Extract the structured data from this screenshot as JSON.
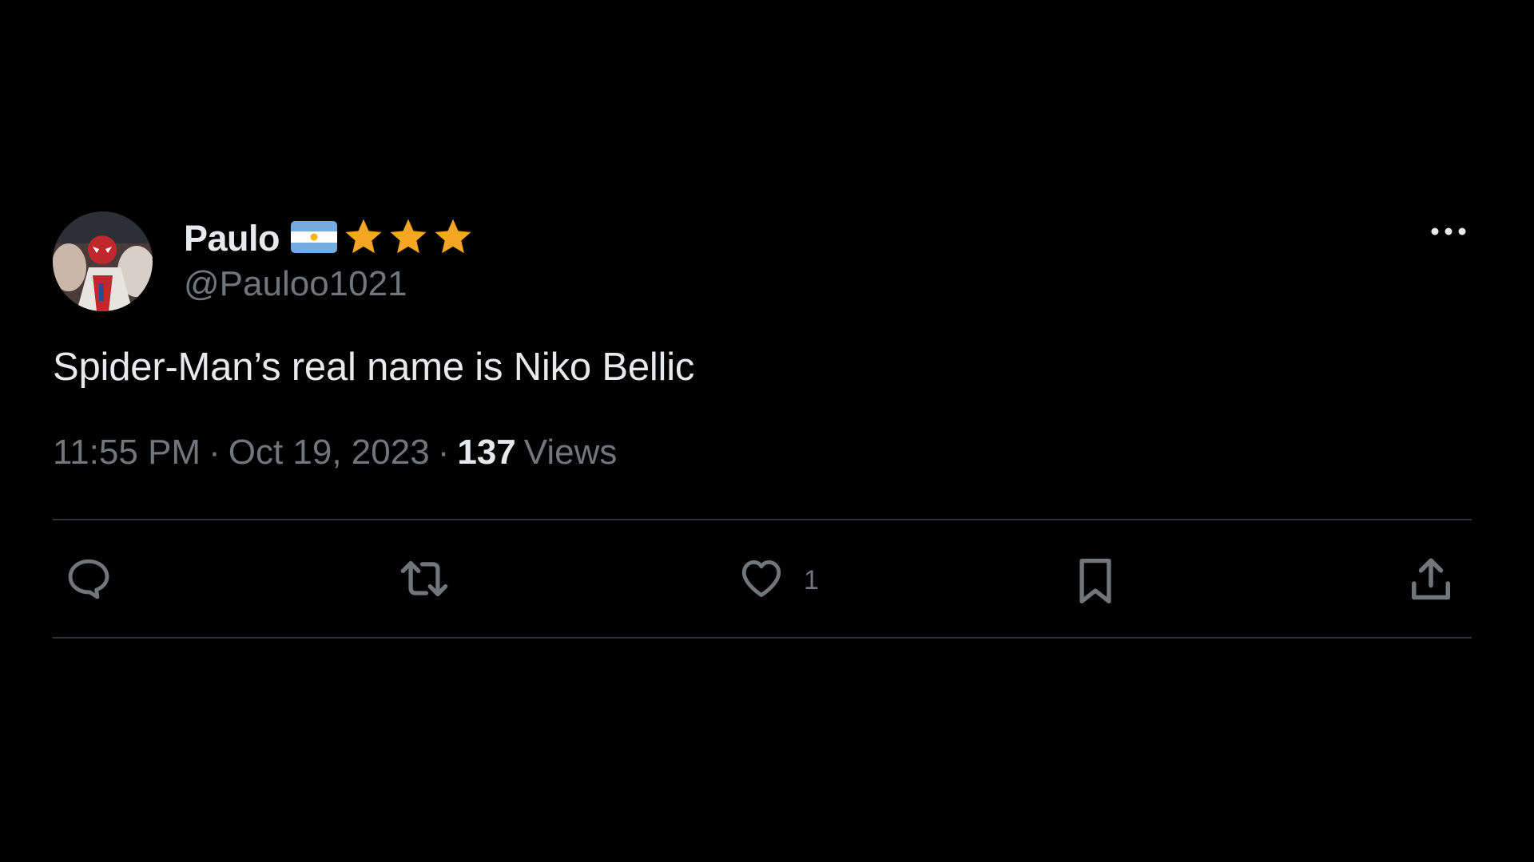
{
  "user": {
    "display_name": "Paulo",
    "handle": "@Pauloo1021",
    "flag_icon": "argentina-flag-icon",
    "badges": [
      "star-icon",
      "star-icon",
      "star-icon"
    ],
    "star_color": "#f5a623"
  },
  "tweet": {
    "text": "Spider-Man’s real name is Niko Bellic",
    "time": "11:55 PM",
    "date": "Oct 19, 2023",
    "separator": "·",
    "views_count": "137",
    "views_label": "Views"
  },
  "actions": {
    "reply_icon": "reply-icon",
    "retweet_icon": "retweet-icon",
    "like_icon": "heart-icon",
    "like_count": "1",
    "bookmark_icon": "bookmark-icon",
    "share_icon": "share-icon"
  },
  "colors": {
    "background": "#000000",
    "text_primary": "#e7e9ea",
    "text_secondary": "#71767b",
    "divider": "#2f3336"
  }
}
